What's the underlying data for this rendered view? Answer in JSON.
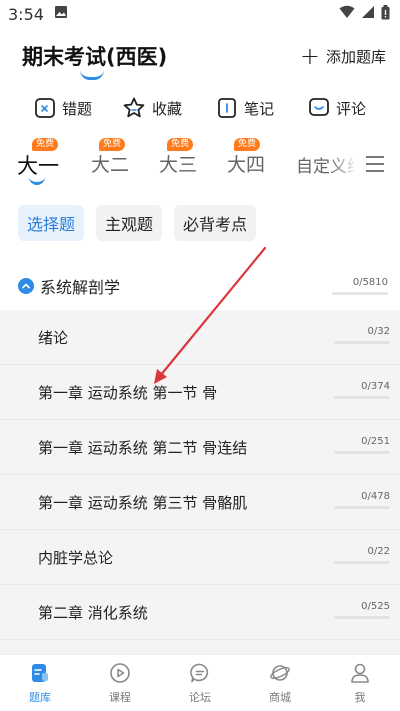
{
  "status": {
    "time": "3:54"
  },
  "header": {
    "title": "期末考试(西医)",
    "add_label": "添加题库"
  },
  "tools": [
    {
      "label": "错题",
      "icon": "wrong-question-icon"
    },
    {
      "label": "收藏",
      "icon": "star-icon"
    },
    {
      "label": "笔记",
      "icon": "note-icon"
    },
    {
      "label": "评论",
      "icon": "comment-icon"
    }
  ],
  "grades": [
    {
      "label": "大一",
      "badge": "免费",
      "active": true
    },
    {
      "label": "大二",
      "badge": "免费"
    },
    {
      "label": "大三",
      "badge": "免费"
    },
    {
      "label": "大四",
      "badge": "免费"
    },
    {
      "label": "自定义组"
    }
  ],
  "chips": [
    {
      "label": "选择题",
      "active": true
    },
    {
      "label": "主观题"
    },
    {
      "label": "必背考点"
    }
  ],
  "section": {
    "name": "系统解剖学",
    "count": "0/5810",
    "progress": 0
  },
  "rows": [
    {
      "label": "绪论",
      "count": "0/32"
    },
    {
      "label": "第一章 运动系统 第一节 骨",
      "count": "0/374"
    },
    {
      "label": "第一章 运动系统 第二节 骨连结",
      "count": "0/251"
    },
    {
      "label": "第一章 运动系统 第三节 骨骼肌",
      "count": "0/478"
    },
    {
      "label": "内脏学总论",
      "count": "0/22"
    },
    {
      "label": "第二章 消化系统",
      "count": "0/525"
    }
  ],
  "tabbar": [
    {
      "label": "题库",
      "icon": "question-bank-icon",
      "active": true
    },
    {
      "label": "课程",
      "icon": "play-course-icon"
    },
    {
      "label": "论坛",
      "icon": "forum-chat-icon"
    },
    {
      "label": "商城",
      "icon": "mall-planet-icon"
    },
    {
      "label": "我",
      "icon": "profile-icon"
    }
  ],
  "colors": {
    "accent": "#2e8be6",
    "badge": "#ff7a1a",
    "annotation_arrow": "#d9363e"
  }
}
